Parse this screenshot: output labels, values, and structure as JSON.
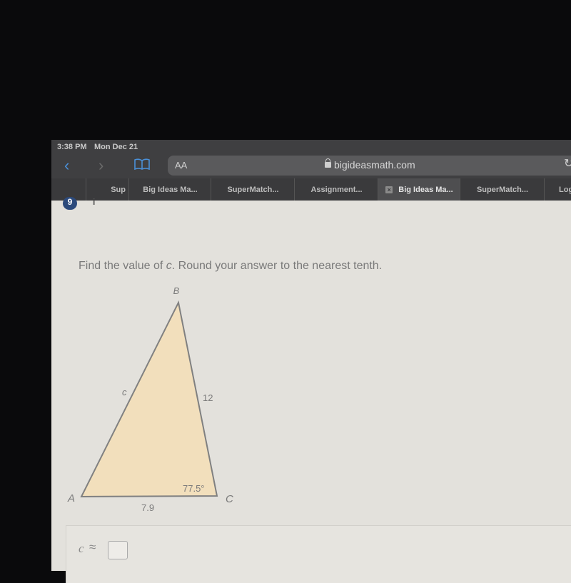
{
  "status_bar": {
    "time": "3:38 PM",
    "date": "Mon Dec 21"
  },
  "browser": {
    "text_size_button": "AA",
    "url": "bigideasmath.com",
    "tabs": [
      {
        "label": "Sup",
        "active": false
      },
      {
        "label": "Big Ideas Ma...",
        "active": false
      },
      {
        "label": "SuperMatch...",
        "active": false
      },
      {
        "label": "Assignment...",
        "active": false
      },
      {
        "label": "Big Ideas Ma...",
        "active": true
      },
      {
        "label": "SuperMatch...",
        "active": false
      },
      {
        "label": "Log",
        "active": false
      }
    ]
  },
  "question": {
    "number": "9",
    "info_label": "i",
    "prompt_before": "Find the value of ",
    "prompt_var": "c",
    "prompt_after": ". Round your answer to the nearest tenth.",
    "figure": {
      "vertices": {
        "A": "A",
        "B": "B",
        "C": "C"
      },
      "side_c_label": "c",
      "side_a_label": "12",
      "side_b_label": "7.9",
      "angle_C_label": "77.5°",
      "fill_color": "#f2dfbc",
      "stroke_color": "#808080"
    },
    "answer": {
      "variable": "c",
      "relation": "≈",
      "value": ""
    }
  }
}
